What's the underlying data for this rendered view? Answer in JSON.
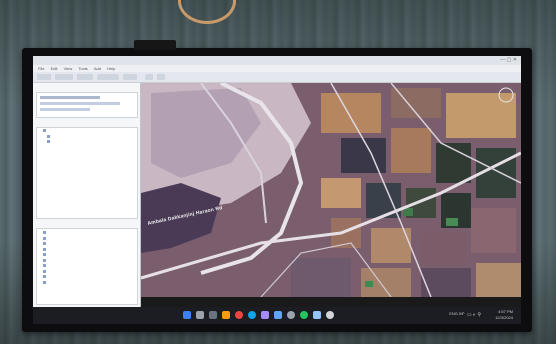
{
  "window": {
    "title": "",
    "menu": [
      "File",
      "Edit",
      "View",
      "Tools",
      "Add",
      "Help"
    ]
  },
  "sidebar": {
    "search_label": "",
    "places_label": "",
    "layers_label": "",
    "places": [
      "",
      "",
      ""
    ],
    "layers": [
      "",
      "",
      "",
      "",
      "",
      "",
      "",
      "",
      "",
      ""
    ]
  },
  "map": {
    "label": "Ambala Dakkanjinj Haraon Rd",
    "status": ""
  },
  "taskbar": {
    "icons": [
      "start",
      "search",
      "task-view",
      "files",
      "chrome",
      "edge",
      "photos",
      "store",
      "settings",
      "whatsapp",
      "mail",
      "app"
    ],
    "tray_lang": "ENG IN",
    "time": "4:57 PM",
    "date": "12/3/2024"
  },
  "colors": {
    "wall": "#5a6b6d",
    "bezel": "#0d0d0f",
    "taskbar": "#1b1d22",
    "sidebar": "#f5f6f8",
    "farmland_dark": "#2f3a33",
    "farmland_orange": "#b98a5a"
  }
}
